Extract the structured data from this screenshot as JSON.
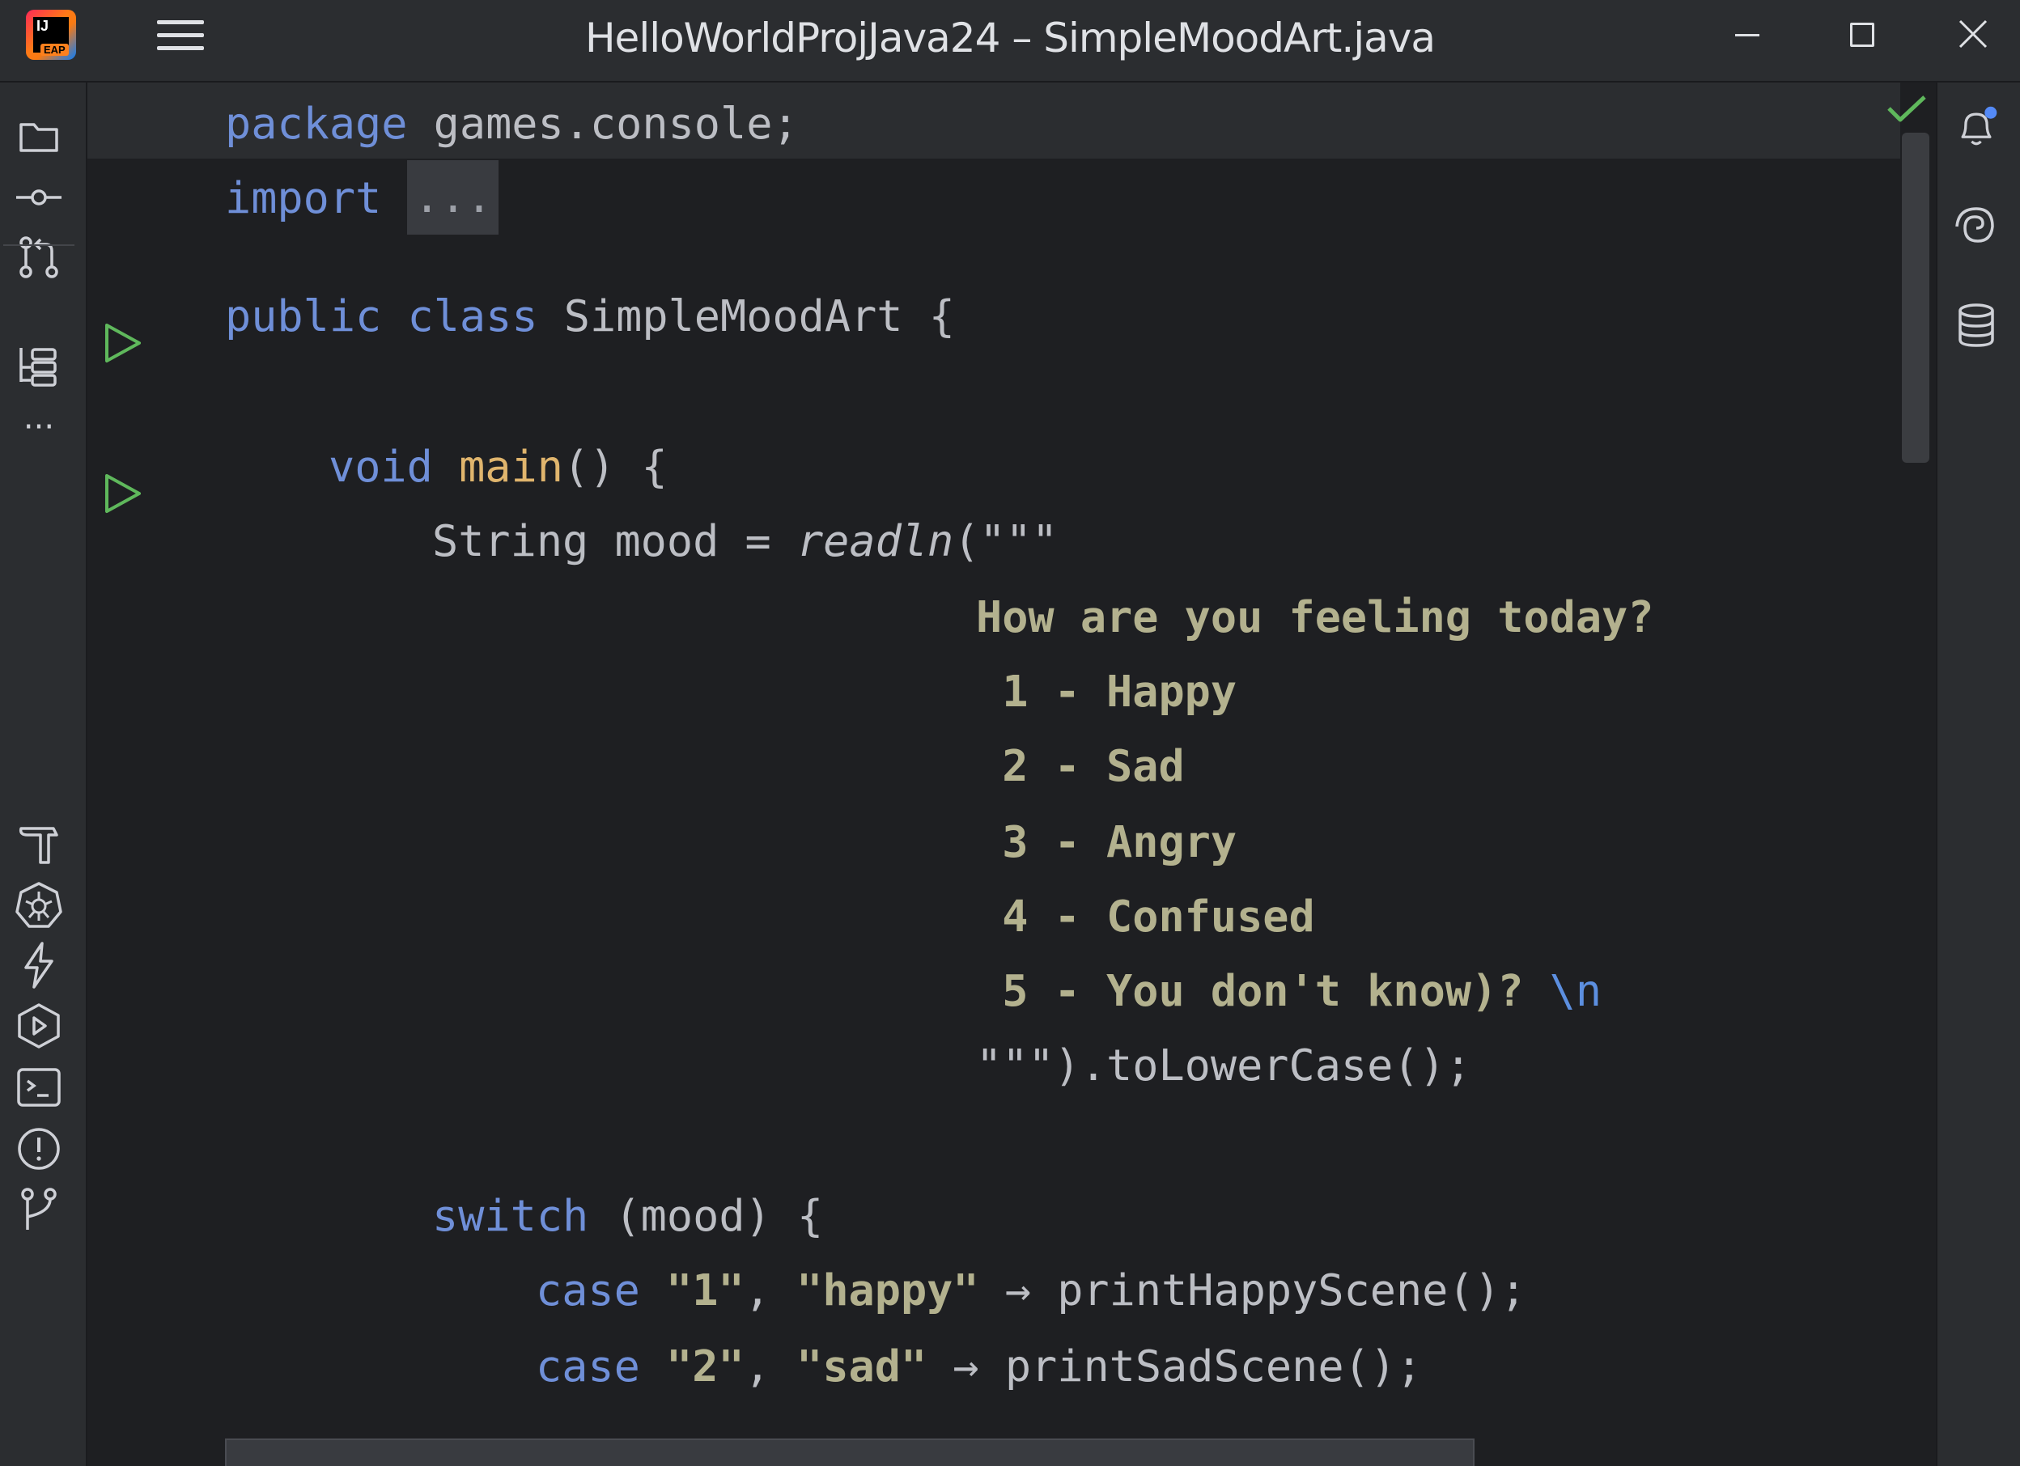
{
  "window": {
    "title": "HelloWorldProjJava24 – SimpleMoodArt.java",
    "logo_text": "IJ",
    "logo_badge": "EAP"
  },
  "left_toolbar": {
    "items": [
      "folder-icon",
      "commit-icon",
      "pull-requests-icon",
      "structure-icon",
      "more-icon",
      "build-icon",
      "kubernetes-icon",
      "services-icon",
      "run-icon",
      "terminal-icon",
      "problems-icon",
      "git-icon"
    ],
    "more_label": "···"
  },
  "right_toolbar": {
    "items": [
      "notifications-icon",
      "ai-assistant-icon",
      "database-icon"
    ],
    "notification_dot_color": "#548af7"
  },
  "editor": {
    "status": "no-problems",
    "lines": {
      "l1_kw": "package",
      "l1_rest": " games.console;",
      "l2_kw": "import",
      "l2_fold": "...",
      "l4_kw1": "public",
      "l4_kw2": "class",
      "l4_rest": " SimpleMoodArt {",
      "l6_kw": "void",
      "l6_fn": "main",
      "l6_rest": "() {",
      "l7_pre": "String mood = ",
      "l7_call": "readln",
      "l7_rest": "(\"\"\"",
      "l8": "How are you feeling today?",
      "l9": " 1 - Happy",
      "l10": " 2 - Sad",
      "l11": " 3 - Angry",
      "l12": " 4 - Confused",
      "l13_text": " 5 - You don't know)? ",
      "l13_esc": "\\n",
      "l14": "\"\"\").toLowerCase();",
      "l16_kw": "switch",
      "l16_rest": " (mood) {",
      "l17_kw": "case",
      "l17_s1": "\"1\"",
      "l17_comma": ", ",
      "l17_s2": "\"happy\"",
      "l17_rest": " → printHappyScene();",
      "l18_kw": "case",
      "l18_s1": "\"2\"",
      "l18_comma": ", ",
      "l18_s2": "\"sad\"",
      "l18_rest": " → printSadScene();"
    }
  },
  "colors": {
    "keyword": "#6f8fd8",
    "function": "#e0b56d",
    "string": "#b3b18e",
    "run_gutter": "#5fb85c",
    "check": "#5fb85c"
  }
}
